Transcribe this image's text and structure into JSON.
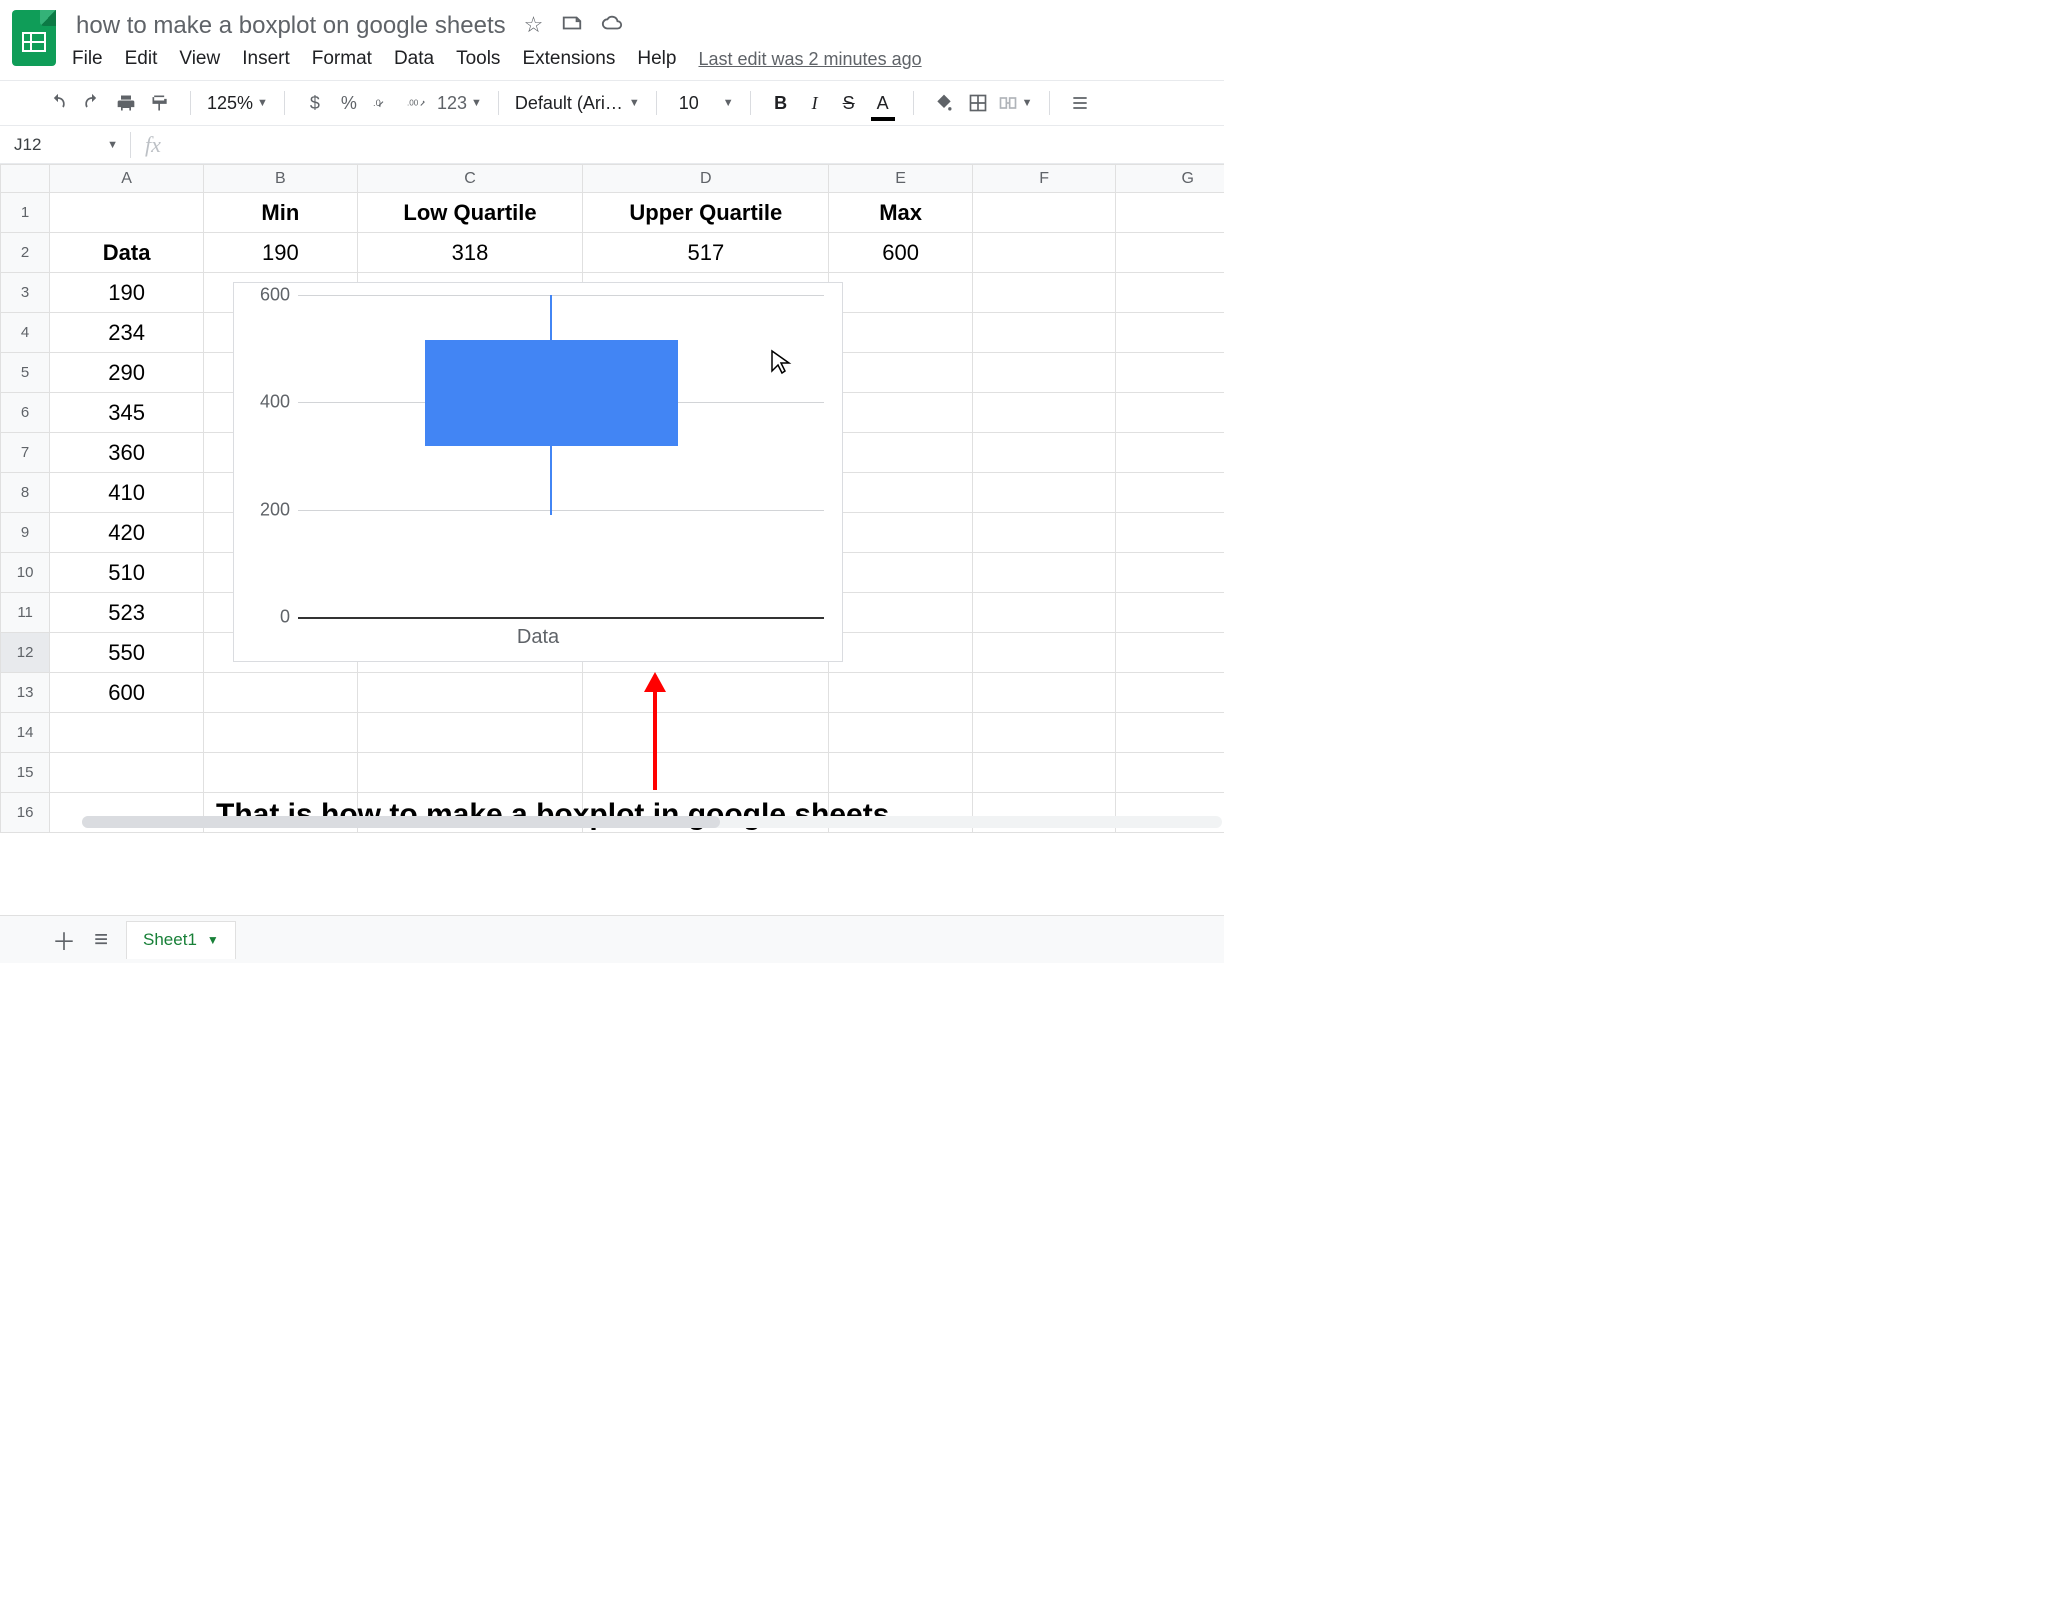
{
  "doc": {
    "title": "how to make a boxplot on google sheets"
  },
  "menu": {
    "file": "File",
    "edit": "Edit",
    "view": "View",
    "insert": "Insert",
    "format": "Format",
    "data": "Data",
    "tools": "Tools",
    "extensions": "Extensions",
    "help": "Help",
    "last_edit": "Last edit was 2 minutes ago"
  },
  "toolbar": {
    "zoom": "125%",
    "currency": "$",
    "percent": "%",
    "dec_dec": ".0",
    "inc_dec": ".00",
    "more_fmt": "123",
    "font": "Default (Ari…",
    "font_size": "10"
  },
  "namebox": {
    "ref": "J12"
  },
  "formula": {
    "value": ""
  },
  "columns": [
    "A",
    "B",
    "C",
    "D",
    "E",
    "F",
    "G"
  ],
  "row_numbers": [
    "1",
    "2",
    "3",
    "4",
    "5",
    "6",
    "7",
    "8",
    "9",
    "10",
    "11",
    "12",
    "13",
    "14",
    "15",
    "16"
  ],
  "cells": {
    "r1": {
      "A": "",
      "B": "Min",
      "C": "Low Quartile",
      "D": "Upper Quartile",
      "E": "Max",
      "F": "",
      "G": ""
    },
    "r2": {
      "A": "Data",
      "B": "190",
      "C": "318",
      "D": "517",
      "E": "600",
      "F": "",
      "G": ""
    },
    "r3": {
      "A": "190"
    },
    "r4": {
      "A": "234"
    },
    "r5": {
      "A": "290"
    },
    "r6": {
      "A": "345"
    },
    "r7": {
      "A": "360"
    },
    "r8": {
      "A": "410"
    },
    "r9": {
      "A": "420"
    },
    "r10": {
      "A": "510"
    },
    "r11": {
      "A": "523"
    },
    "r12": {
      "A": "550"
    },
    "r13": {
      "A": "600"
    }
  },
  "chart_data": {
    "type": "boxplot",
    "categories": [
      "Data"
    ],
    "series": [
      {
        "name": "Data",
        "min": 190,
        "q1": 318,
        "q3": 517,
        "max": 600
      }
    ],
    "xlabel": "Data",
    "ylabel": "",
    "ylim": [
      0,
      600
    ],
    "yticks": [
      0,
      200,
      400,
      600
    ],
    "ytick_labels": [
      "0",
      "200",
      "400",
      "600"
    ]
  },
  "annotation": {
    "caption": "That is how to make a boxplot in google sheets"
  },
  "tabs": {
    "sheet1": "Sheet1"
  }
}
